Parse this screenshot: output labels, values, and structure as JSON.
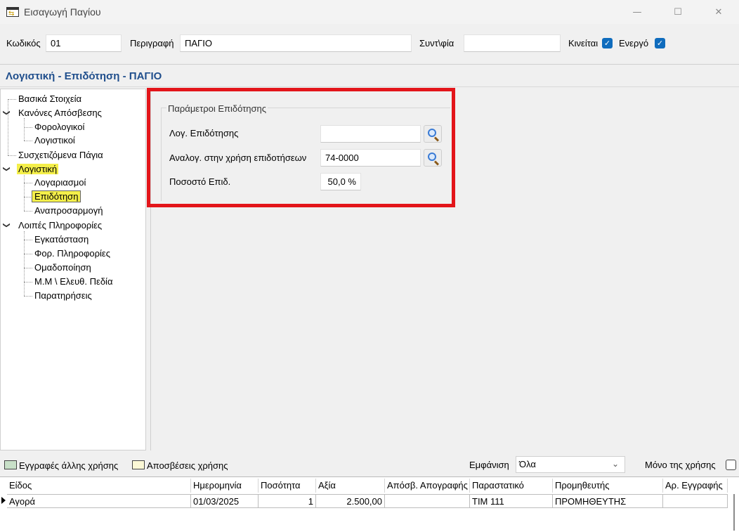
{
  "window": {
    "title": "Εισαγωγή Παγίου",
    "controls": {
      "minimize": "—",
      "maximize": "☐",
      "close": "✕"
    }
  },
  "header": {
    "code_label": "Κωδικός",
    "code_value": "01",
    "description_label": "Περιγραφή",
    "description_value": "ΠΑΓΙΟ",
    "abbrev_label": "Συντ\\φία",
    "abbrev_value": "",
    "movable_label": "Κινείται",
    "movable_checked": true,
    "active_label": "Ενεργό",
    "active_checked": true
  },
  "section_title": "Λογιστική - Επιδότηση - ΠΑΓΙΟ",
  "tree": {
    "basic": "Βασικά Στοιχεία",
    "depreciation_rules": "Κανόνες Απόσβεσης",
    "tax": "Φορολογικοί",
    "accounting_rules": "Λογιστικοί",
    "related": "Συσχετιζόμενα Πάγια",
    "accounting": "Λογιστική",
    "accounts": "Λογαριασμοί",
    "subsidy": "Επιδότηση",
    "revaluation": "Αναπροσαρμογή",
    "other_info": "Λοιπές Πληροφορίες",
    "installation": "Εγκατάσταση",
    "tax_info": "Φορ. Πληροφορίες",
    "grouping": "Ομαδοποίηση",
    "mm_free": "Μ.Μ \\ Ελευθ. Πεδία",
    "notes": "Παρατηρήσεις"
  },
  "subsidy_params": {
    "group_title": "Παράμετροι Επιδότησης",
    "account_label": "Λογ. Επιδότησης",
    "account_value": "",
    "usage_label": "Αναλογ. στην χρήση επιδοτήσεων",
    "usage_value": "74-0000",
    "percent_label": "Ποσοστό Επιδ.",
    "percent_value": "50,0 %"
  },
  "bottom": {
    "other_year_label": "Εγγραφές άλλης χρήσης",
    "other_year_color": "#c8e0c8",
    "depr_year_label": "Αποσβέσεις χρήσης",
    "depr_year_color": "#fbf8d6",
    "display_label": "Εμφάνιση",
    "display_value": "Όλα",
    "only_year_label": "Μόνο της χρήσης",
    "only_year_checked": false
  },
  "table": {
    "columns": {
      "type": "Είδος",
      "date": "Ημερομηνία",
      "qty": "Ποσότητα",
      "value": "Αξία",
      "inventory_depr": "Απόσβ. Απογραφής",
      "document": "Παραστατικό",
      "supplier": "Προμηθευτής",
      "entry_no": "Αρ. Εγγραφής"
    },
    "rows": [
      {
        "type": "Αγορά",
        "date": "01/03/2025",
        "qty": "1",
        "value": "2.500,00",
        "inventory_depr": "",
        "document": "ΤΙΜ 111",
        "supplier": "ΠΡΟΜΗΘΕΥΤΗΣ",
        "entry_no": ""
      }
    ]
  }
}
